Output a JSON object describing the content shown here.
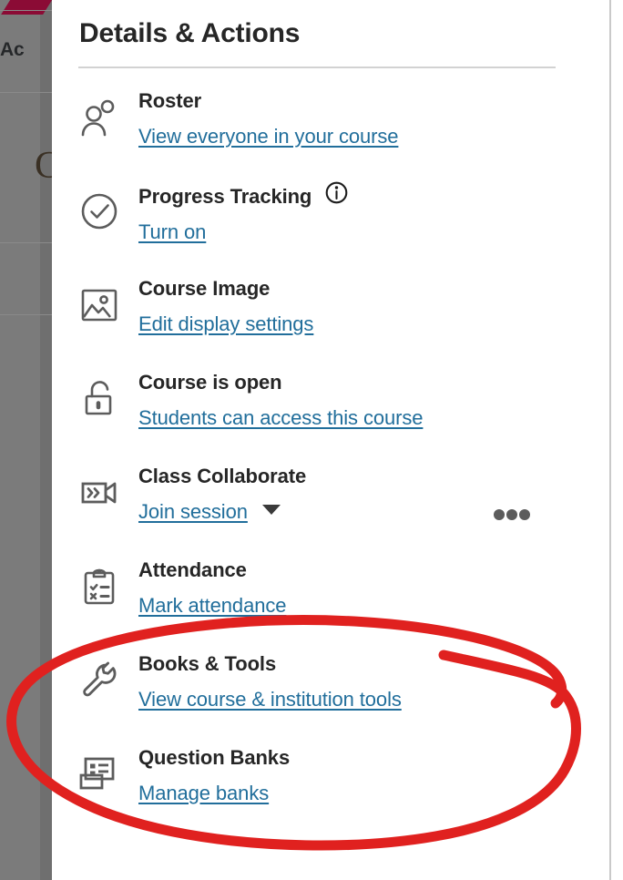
{
  "panel": {
    "title": "Details & Actions",
    "overflow_button_label": "More options",
    "items": [
      {
        "icon": "people-icon",
        "label": "Roster",
        "link": "View everyone in your course",
        "has_info": false,
        "has_caret": false
      },
      {
        "icon": "check-circle-icon",
        "label": "Progress Tracking",
        "link": "Turn on",
        "has_info": true,
        "has_caret": false
      },
      {
        "icon": "image-icon",
        "label": "Course Image",
        "link": "Edit display settings",
        "has_info": false,
        "has_caret": false
      },
      {
        "icon": "unlock-icon",
        "label": "Course is open",
        "link": "Students can access this course",
        "has_info": false,
        "has_caret": false
      },
      {
        "icon": "video-camera-icon",
        "label": "Class Collaborate",
        "link": "Join session",
        "has_info": false,
        "has_caret": true
      },
      {
        "icon": "clipboard-check-icon",
        "label": "Attendance",
        "link": "Mark attendance",
        "has_info": false,
        "has_caret": false
      },
      {
        "icon": "wrench-icon",
        "label": "Books & Tools",
        "link": "View course & institution tools",
        "has_info": false,
        "has_caret": false
      },
      {
        "icon": "card-list-icon",
        "label": "Question Banks",
        "link": "Manage banks",
        "has_info": false,
        "has_caret": false
      }
    ]
  },
  "background": {
    "partial_text": "Ac",
    "partial_glyph": "C"
  },
  "annotation": {
    "shape": "hand-drawn-ellipse",
    "color": "#e0211f",
    "encircles": [
      "Books & Tools",
      "Question Banks"
    ]
  },
  "colors": {
    "link": "#216e9b",
    "label": "#262626",
    "icon": "#5c5c5c",
    "divider": "#d2d2d2",
    "annotation_red": "#e0211f",
    "brand_maroon": "#8b0b35",
    "backdrop_dim": "#7b7b7b"
  }
}
